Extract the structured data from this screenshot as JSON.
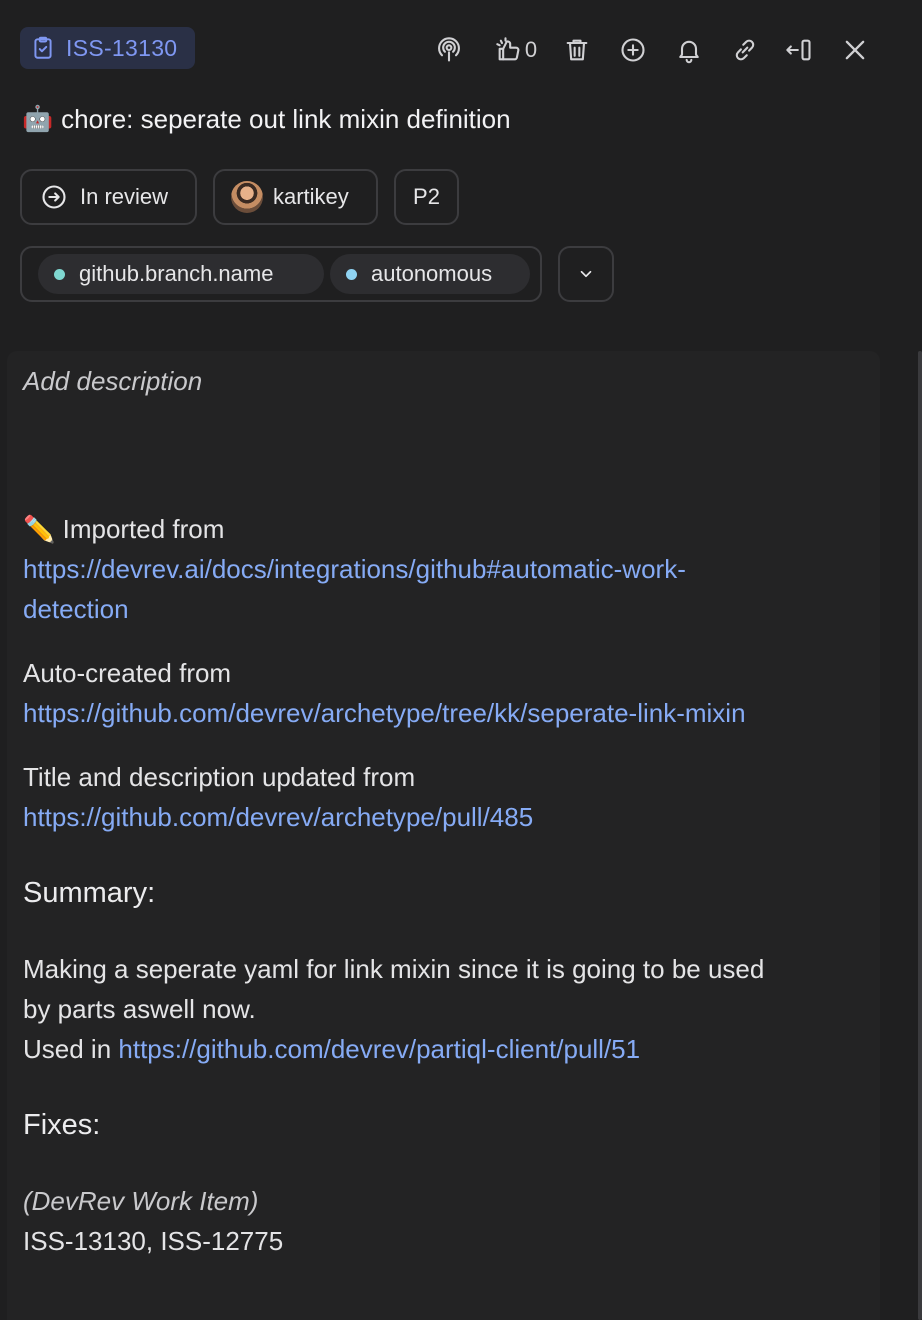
{
  "header": {
    "item_id": "ISS-13130",
    "upvote_count": "0",
    "toolbar_icons": [
      "podcast-icon",
      "thumbs-up-sparkle-icon",
      "trash-icon",
      "add-circle-icon",
      "bell-icon",
      "link-icon",
      "collapse-panel-icon",
      "close-icon"
    ]
  },
  "title": {
    "emoji": "🤖",
    "text": "chore: seperate out link mixin definition"
  },
  "chips": {
    "status": "In review",
    "assignee": "kartikey",
    "priority": "P2"
  },
  "tags": [
    {
      "label": "github.branch.name",
      "color": "#7fd7d0"
    },
    {
      "label": "autonomous",
      "color": "#8fd3f2"
    }
  ],
  "description": {
    "placeholder": "Add description",
    "imported_prefix": "✏️ Imported from",
    "imported_link_1": "https://devrev.ai/docs/integrations/github#automatic-work-",
    "imported_link_2": "detection",
    "auto_created_label": "Auto-created from",
    "auto_created_link": "https://github.com/devrev/archetype/tree/kk/seperate-link-mixin",
    "updated_label": "Title and description updated from",
    "updated_link": "https://github.com/devrev/archetype/pull/485",
    "summary_heading": "Summary:",
    "summary_line_1": "Making a seperate yaml for link mixin since it is going to be used",
    "summary_line_2": "by parts aswell now.",
    "used_in_label": "Used in ",
    "used_in_link": "https://github.com/devrev/partiql-client/pull/51",
    "fixes_heading": "Fixes:",
    "fixes_note": "(DevRev Work Item)",
    "fixes_items": "ISS-13130, ISS-12775"
  },
  "colors": {
    "background": "#1f1f20",
    "link": "#86abf5",
    "badge_text": "#7f97f2",
    "badge_bg": "#2a3046"
  }
}
